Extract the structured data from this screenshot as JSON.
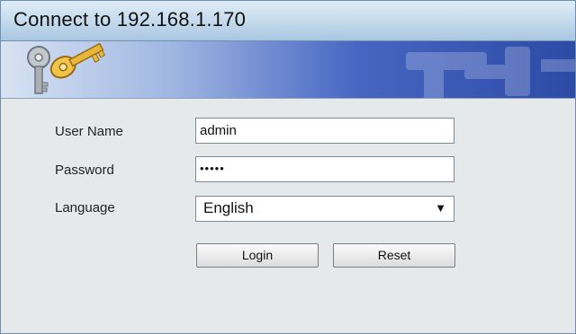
{
  "window": {
    "title": "Connect to 192.168.1.170"
  },
  "banner": {
    "icon": "keys-icon"
  },
  "form": {
    "username": {
      "label": "User Name",
      "value": "admin"
    },
    "password": {
      "label": "Password",
      "value": "•••••"
    },
    "language": {
      "label": "Language",
      "selected": "English"
    },
    "login_label": "Login",
    "reset_label": "Reset"
  },
  "colors": {
    "titlebar": "#c3d9ec",
    "banner_dark": "#2c4ba6",
    "body": "#e6e9ea",
    "key_gold": "#e8b63a",
    "key_silver": "#9ea4aa"
  }
}
